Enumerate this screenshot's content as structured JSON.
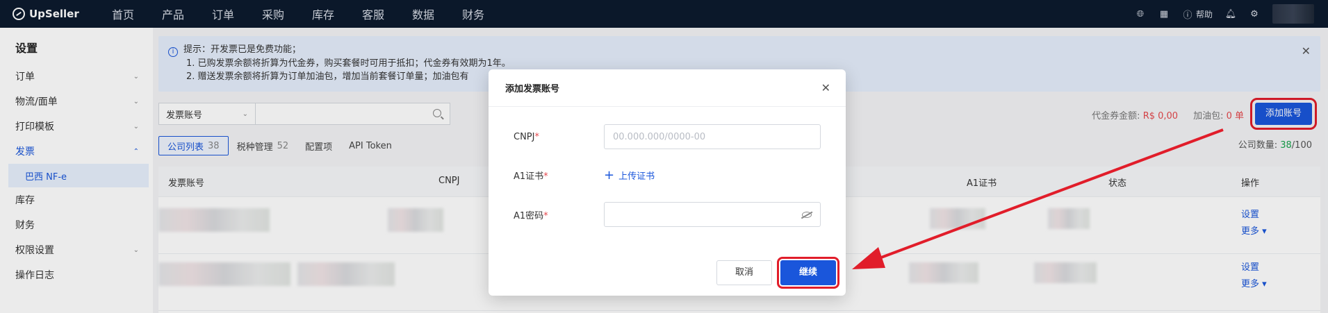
{
  "brand": {
    "name": "UpSeller"
  },
  "nav": [
    "首页",
    "产品",
    "订单",
    "采购",
    "库存",
    "客服",
    "数据",
    "财务"
  ],
  "topbar": {
    "help_label": "帮助",
    "icons": [
      "globe-icon",
      "grid-icon",
      "help-icon",
      "bell-icon",
      "gear-icon"
    ]
  },
  "sidebar": {
    "title": "设置",
    "items": [
      {
        "label": "订单",
        "expandable": true
      },
      {
        "label": "物流/面单",
        "expandable": true
      },
      {
        "label": "打印模板",
        "expandable": true
      },
      {
        "label": "发票",
        "expandable": true,
        "active": true
      },
      {
        "label": "巴西 NF-e",
        "sub": true
      },
      {
        "label": "库存"
      },
      {
        "label": "财务"
      },
      {
        "label": "权限设置",
        "expandable": true
      },
      {
        "label": "操作日志"
      }
    ]
  },
  "notice": {
    "line1": "提示：开发票已是免费功能；",
    "line2": "1. 已购发票余额将折算为代金券，购买套餐时可用于抵扣；代金券有效期为1年。",
    "line3": "2. 赠送发票余额将折算为订单加油包，增加当前套餐订单量；加油包有"
  },
  "filter": {
    "select_label": "发票账号",
    "search_placeholder": ""
  },
  "stats": {
    "voucher_label": "代金券金额: ",
    "voucher_value": "R$ 0,00",
    "fuel_label": "加油包: ",
    "fuel_value": "0 单",
    "add_button": "添加账号",
    "company_count_label": "公司数量: ",
    "company_count_value": "38",
    "company_count_total": "/100"
  },
  "tabs": [
    {
      "label": "公司列表",
      "count": "38",
      "active": true
    },
    {
      "label": "税种管理",
      "count": "52"
    },
    {
      "label": "配置项",
      "count": ""
    },
    {
      "label": "API Token",
      "count": ""
    }
  ],
  "table": {
    "headers": [
      "发票账号",
      "CNPJ",
      "A1证书",
      "状态",
      "操作"
    ],
    "rows": [
      {
        "action1": "设置",
        "action2": "更多 ▾"
      },
      {
        "action1": "设置",
        "action2": "更多 ▾"
      }
    ]
  },
  "modal": {
    "title": "添加发票账号",
    "fields": {
      "cnpj_label": "CNPJ",
      "cnpj_placeholder": "00.000.000/0000-00",
      "cert_label": "A1证书",
      "upload_label": "上传证书",
      "password_label": "A1密码",
      "password_value": ""
    },
    "cancel": "取消",
    "continue": "继续"
  },
  "colors": {
    "brand_blue": "#1a56db",
    "highlight_red": "#e11d2a",
    "nav_bg": "#0d1b2e"
  }
}
